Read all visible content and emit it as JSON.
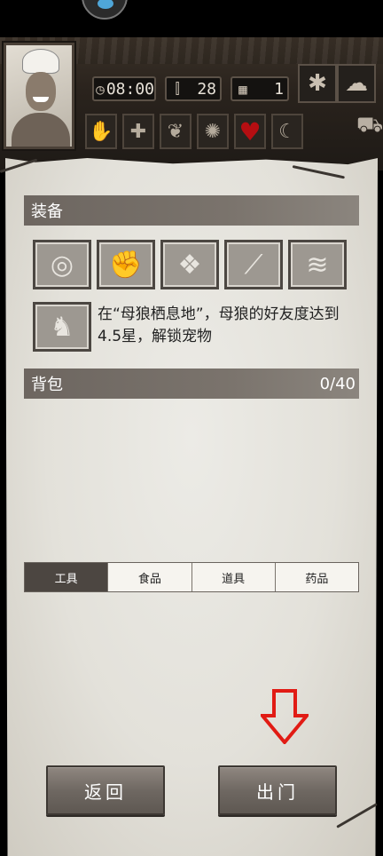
{
  "hud": {
    "time": "08:00",
    "temperature": "28",
    "day": "1",
    "time_icon": "clock-icon",
    "temp_icon": "thermometer-icon",
    "day_icon": "calendar-icon",
    "weather_icons": [
      "leaf-icon",
      "cloud-icon"
    ],
    "status_icons": [
      "hand-icon",
      "plus-icon",
      "stomach-icon",
      "brain-icon",
      "heart-icon",
      "moon-icon"
    ],
    "heart_color": "#b50e12"
  },
  "equipment": {
    "title": "装备",
    "slots": [
      "target-icon",
      "fist-icon",
      "shirt-icon",
      "torch-icon",
      "logs-icon"
    ],
    "pet_icon": "wolf-icon",
    "pet_hint": "在“母狼栖息地”，母狼的好友度达到4.5星，解锁宠物"
  },
  "backpack": {
    "title": "背包",
    "count": "0/40"
  },
  "tabs": [
    "工具",
    "食品",
    "道具",
    "药品"
  ],
  "buttons": {
    "back": "返回",
    "go_out": "出门"
  },
  "accent_arrow_color": "#e11b14"
}
